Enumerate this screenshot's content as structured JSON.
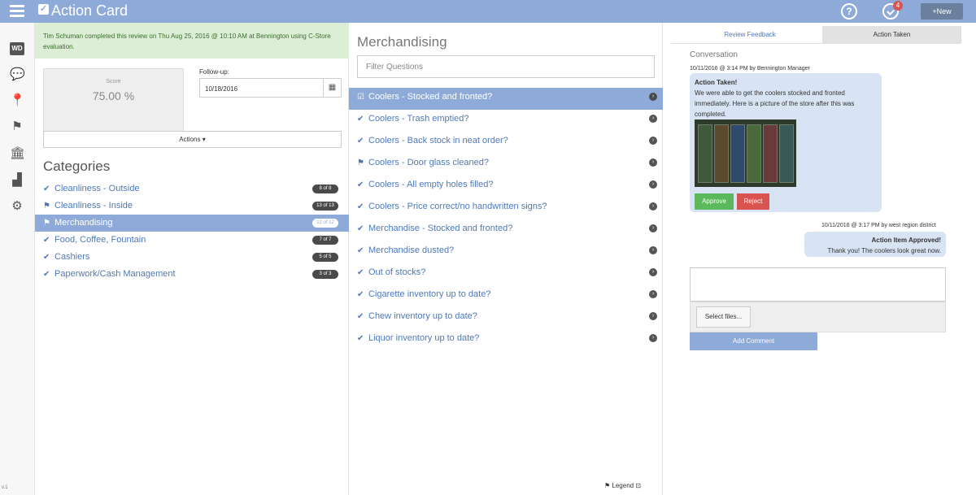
{
  "app": {
    "title": "Action Card",
    "new_button": "+New"
  },
  "notifications": {
    "count": "4"
  },
  "rail": {
    "version": "v.1"
  },
  "review": {
    "note": "Tim Schuman completed this review on Thu Aug 25, 2016 @ 10:10 AM at Bennington using C-Store evaluation.",
    "score_label": "Score",
    "score_value": "75.00 %",
    "followup_label": "Follow-up:",
    "followup_value": "10/18/2016",
    "actions_label": "Actions"
  },
  "categories": {
    "title": "Categories",
    "items": [
      {
        "label": "Cleanliness - Outside",
        "count": "8 of 8",
        "icon": "check-icon"
      },
      {
        "label": "Cleanliness - Inside",
        "count": "13 of 13",
        "icon": "flag-icon"
      },
      {
        "label": "Merchandising",
        "count": "12 of 12",
        "icon": "flag-icon"
      },
      {
        "label": "Food, Coffee, Fountain",
        "count": "7 of 7",
        "icon": "check-icon"
      },
      {
        "label": "Cashiers",
        "count": "5 of 5",
        "icon": "check-icon"
      },
      {
        "label": "Paperwork/Cash Management",
        "count": "3 of 3",
        "icon": "check-icon"
      }
    ]
  },
  "questions": {
    "title": "Merchandising",
    "filter_placeholder": "Filter Questions",
    "items": [
      {
        "label": "Coolers - Stocked and fronted?",
        "icon": "checkbox-icon"
      },
      {
        "label": "Coolers - Trash emptied?",
        "icon": "check-icon"
      },
      {
        "label": "Coolers - Back stock in neat order?",
        "icon": "check-icon"
      },
      {
        "label": "Coolers - Door glass cleaned?",
        "icon": "flag-icon"
      },
      {
        "label": "Coolers - All empty holes filled?",
        "icon": "check-icon"
      },
      {
        "label": "Coolers - Price correct/no handwritten signs?",
        "icon": "check-icon"
      },
      {
        "label": "Merchandise - Stocked and fronted?",
        "icon": "check-icon"
      },
      {
        "label": "Merchandise dusted?",
        "icon": "check-icon"
      },
      {
        "label": "Out of stocks?",
        "icon": "check-icon"
      },
      {
        "label": "Cigarette inventory up to date?",
        "icon": "check-icon"
      },
      {
        "label": "Chew inventory up to date?",
        "icon": "check-icon"
      },
      {
        "label": "Liquor inventory up to date?",
        "icon": "check-icon"
      }
    ],
    "legend_label": "Legend"
  },
  "feedback": {
    "tabs": [
      "Review Feedback",
      "Action Taken"
    ],
    "conversation_title": "Conversation",
    "message1": {
      "meta": "10/11/2016 @ 3:14 PM by Bennington Manager",
      "head": "Action Taken!",
      "body": "We were able to get the coolers stocked and fronted immediately. Here is a picture of the store after this was completed.",
      "approve_label": "Approve",
      "reject_label": "Reject"
    },
    "message2": {
      "meta": "10/11/2016 @ 3:17 PM by west region district",
      "head": "Action Item Approved!",
      "body": "Thank you! The coolers look great now."
    },
    "select_files_label": "Select files...",
    "add_comment_label": "Add Comment"
  },
  "colors": {
    "accent": "#8eaad8",
    "link": "#4e79b8",
    "approve": "#5cb85c",
    "reject": "#d9534f",
    "note_bg": "#dcefd6"
  }
}
